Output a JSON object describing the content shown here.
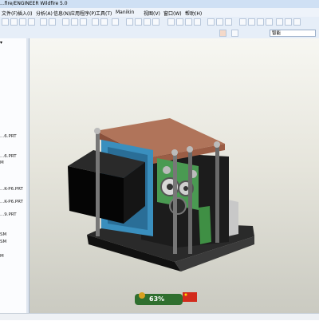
{
  "window": {
    "title": "...fire/ENGINEER Wildfire 5.0"
  },
  "menu": {
    "items": [
      "文件(F)",
      "插入(I)",
      "分析(A)",
      "信息(N)",
      "应用程序(P)",
      "工具(T)",
      "Manikin",
      "视图(V)",
      "窗口(W)",
      "帮助(H)"
    ]
  },
  "toolbar": {
    "search_placeholder": "智能"
  },
  "sidebar": {
    "tree_items": [
      "...6.PRT",
      "...6.PRT",
      "M",
      "...K-P6.PRT",
      "...K-P6.PRT",
      "...9.PRT",
      "SM",
      "SM",
      "M",
      "..."
    ]
  },
  "widget": {
    "percent": "63%"
  },
  "icons": [
    "new-icon",
    "open-icon",
    "save-icon",
    "print-icon",
    "undo-icon",
    "redo-icon",
    "zoom-in-icon",
    "zoom-out-icon",
    "refit-icon",
    "rotate-icon",
    "view-icon",
    "layers-icon",
    "datum-icon"
  ],
  "colors": {
    "accent": "#cfe0f4",
    "viewport_top": "#f7f7f2",
    "viewport_bottom": "#c9c9c0"
  }
}
